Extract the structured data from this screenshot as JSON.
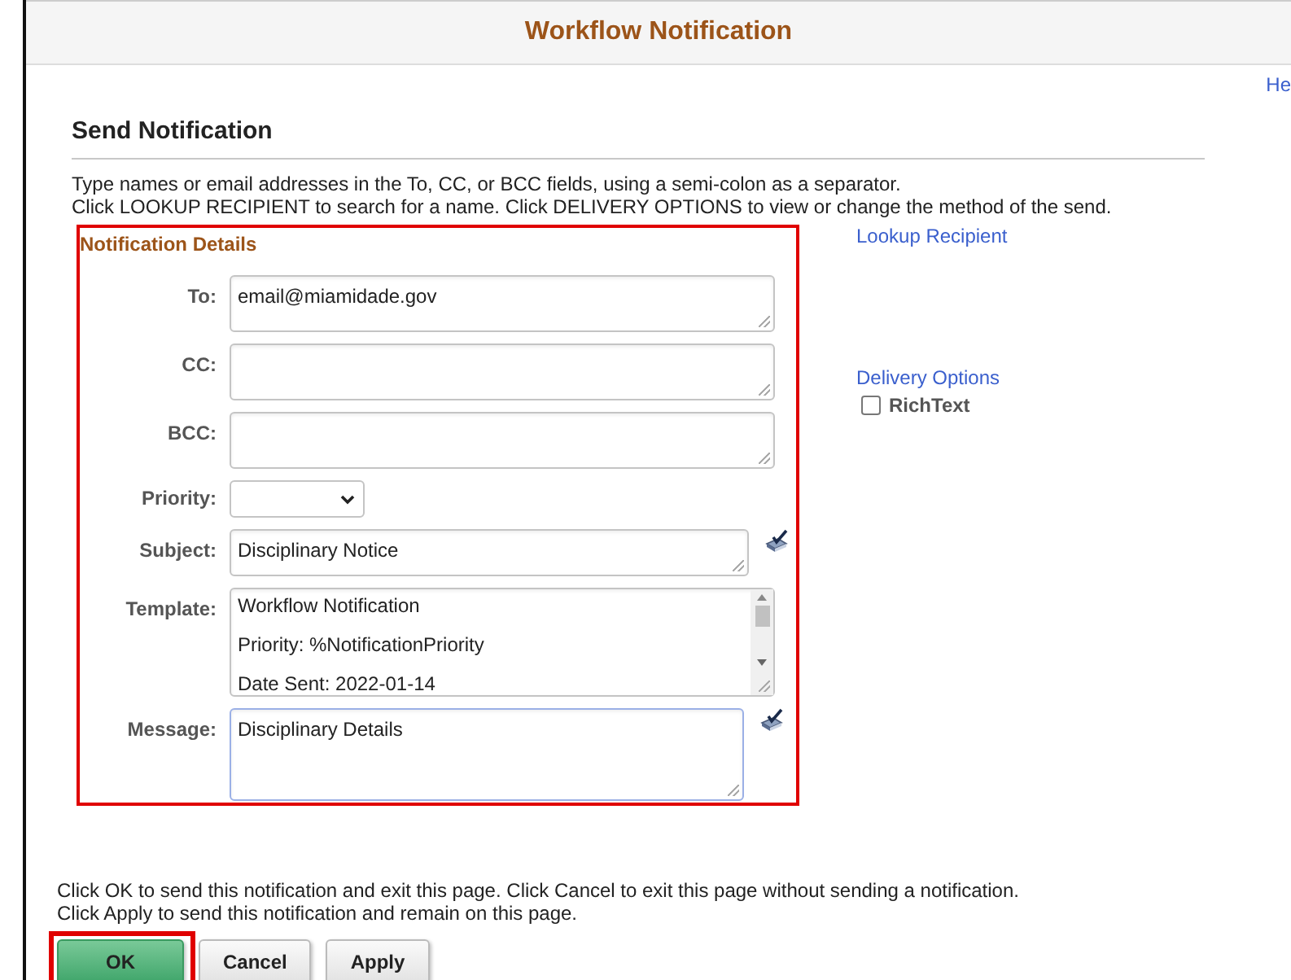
{
  "window": {
    "title": "Workflow Notification",
    "help_link": "He"
  },
  "page": {
    "heading": "Send Notification",
    "instructions": [
      "Type names or email addresses in the To, CC, or BCC fields, using a semi-colon as a separator.",
      "Click LOOKUP RECIPIENT to search for a name.  Click DELIVERY OPTIONS to view or change the method of the send."
    ]
  },
  "details": {
    "title": "Notification Details",
    "highlighted": true,
    "fields": [
      {
        "kind": "address",
        "label": "To:",
        "value": "email@miamidade.gov"
      },
      {
        "kind": "address",
        "label": "CC:"
      },
      {
        "kind": "address",
        "label": "BCC:"
      },
      {
        "kind": "select",
        "label": "Priority:"
      },
      {
        "kind": "subject",
        "label": "Subject:",
        "value": "Disciplinary Notice"
      },
      {
        "kind": "template",
        "label": "Template:",
        "lines": [
          "Workflow Notification",
          "Priority:  %NotificationPriority",
          "Date Sent:  2022-01-14"
        ]
      },
      {
        "kind": "message",
        "label": "Message:",
        "value": "Disciplinary Details",
        "focused": true
      }
    ]
  },
  "side": {
    "lookup_link": "Lookup Recipient",
    "delivery_link": "Delivery Options",
    "richtext": {
      "label": "RichText",
      "checked": false
    }
  },
  "footer": {
    "instructions": [
      "Click OK to send this notification and exit this page.  Click Cancel to exit this page without sending a notification.",
      "Click Apply to send this notification and remain on this page."
    ],
    "buttons": [
      {
        "label": "OK",
        "primary": true,
        "highlighted": true
      },
      {
        "label": "Cancel",
        "primary": false,
        "highlighted": false
      },
      {
        "label": "Apply",
        "primary": false,
        "highlighted": false
      }
    ]
  }
}
